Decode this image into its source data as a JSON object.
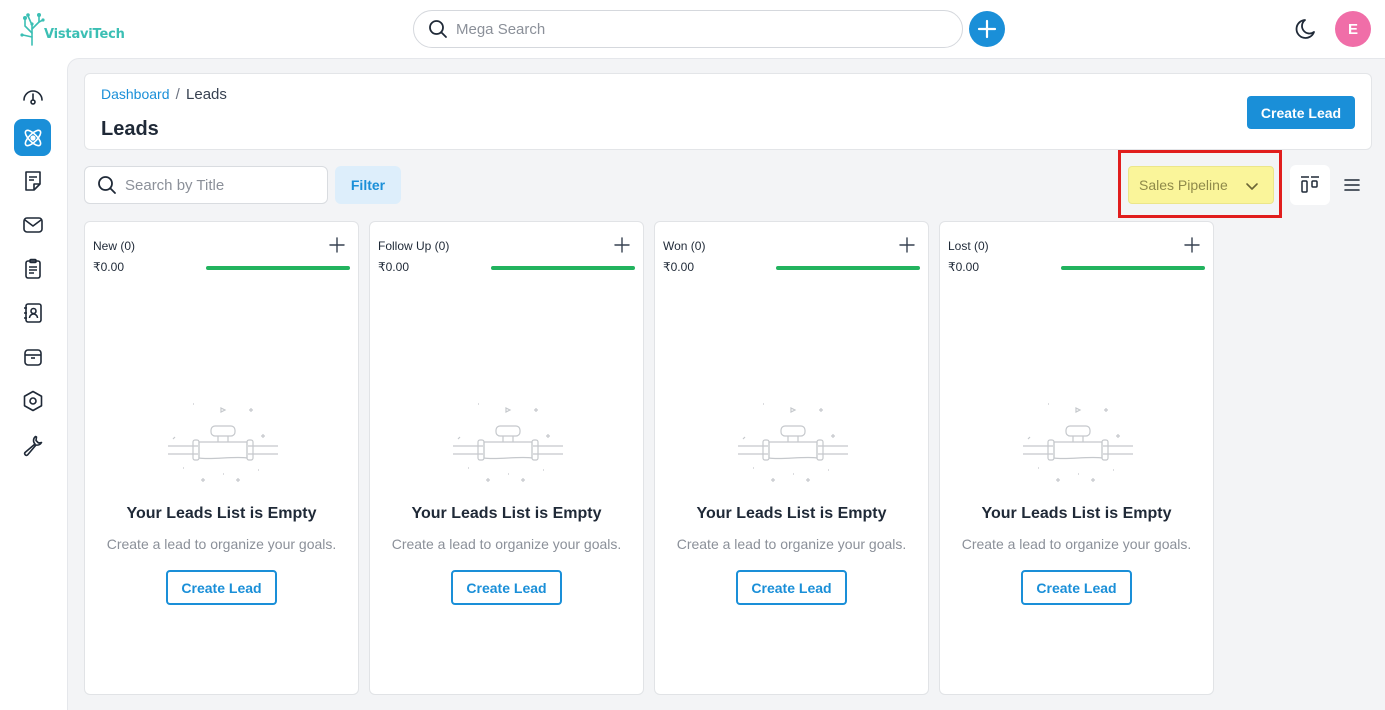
{
  "app": {
    "logo_text": "VistaviTech",
    "avatar_letter": "E"
  },
  "topbar": {
    "search_placeholder": "Mega Search"
  },
  "sidebar": {
    "items": [
      {
        "name": "dashboard",
        "icon": "speedometer-icon",
        "active": false
      },
      {
        "name": "leads",
        "icon": "atom-icon",
        "active": true
      },
      {
        "name": "notes",
        "icon": "note-icon",
        "active": false
      },
      {
        "name": "mail",
        "icon": "mail-icon",
        "active": false
      },
      {
        "name": "tasks",
        "icon": "clipboard-icon",
        "active": false
      },
      {
        "name": "contacts",
        "icon": "contact-book-icon",
        "active": false
      },
      {
        "name": "archive",
        "icon": "archive-icon",
        "active": false
      },
      {
        "name": "settings",
        "icon": "hexagon-gear-icon",
        "active": false
      },
      {
        "name": "tools",
        "icon": "wrench-icon",
        "active": false
      }
    ]
  },
  "header": {
    "breadcrumb": {
      "link": "Dashboard",
      "separator": "/",
      "current": "Leads"
    },
    "title": "Leads",
    "create_button": "Create Lead"
  },
  "toolbar": {
    "search_placeholder": "Search by Title",
    "filter_label": "Filter",
    "pipeline_selected": "Sales Pipeline"
  },
  "columns": [
    {
      "title": "New (0)",
      "amount": "₹0.00",
      "empty_title": "Your Leads List is Empty",
      "empty_desc": "Create a lead to organize your goals.",
      "button": "Create Lead"
    },
    {
      "title": "Follow Up (0)",
      "amount": "₹0.00",
      "empty_title": "Your Leads List is Empty",
      "empty_desc": "Create a lead to organize your goals.",
      "button": "Create Lead"
    },
    {
      "title": "Won (0)",
      "amount": "₹0.00",
      "empty_title": "Your Leads List is Empty",
      "empty_desc": "Create a lead to organize your goals.",
      "button": "Create Lead"
    },
    {
      "title": "Lost (0)",
      "amount": "₹0.00",
      "empty_title": "Your Leads List is Empty",
      "empty_desc": "Create a lead to organize your goals.",
      "button": "Create Lead"
    }
  ],
  "colors": {
    "primary": "#1a8fd8",
    "progress": "#22b35e",
    "avatar": "#f06ea8",
    "highlight": "#faf59a",
    "highlight_border": "#e11d1d"
  }
}
